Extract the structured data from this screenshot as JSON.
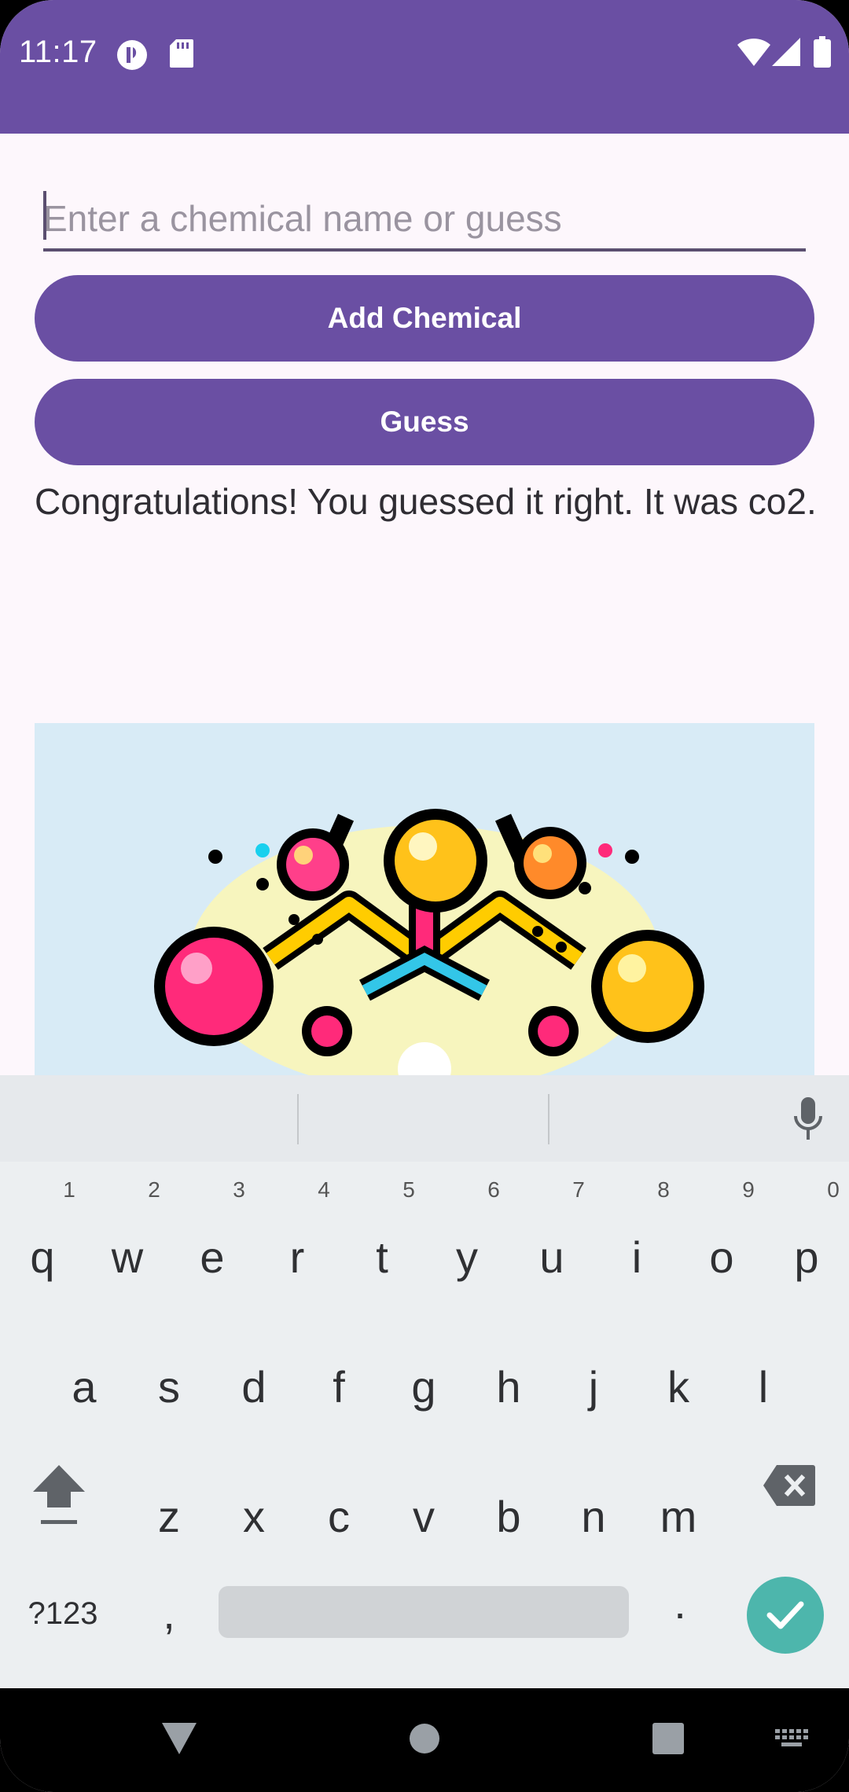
{
  "status_bar": {
    "time": "11:17",
    "icons": [
      "app-notification-icon",
      "sd-card-icon",
      "wifi-icon",
      "signal-icon",
      "battery-icon"
    ],
    "color": "#6a4fa3"
  },
  "form": {
    "input_placeholder": "Enter a chemical name or guess",
    "add_label": "Add Chemical",
    "guess_label": "Guess"
  },
  "result": {
    "message": "Congratulations! You guessed it right. It was co2."
  },
  "image": {
    "icon": "molecule-illustration",
    "background": "#d8ebf6"
  },
  "keyboard": {
    "row1": [
      "q",
      "w",
      "e",
      "r",
      "t",
      "y",
      "u",
      "i",
      "o",
      "p"
    ],
    "row1_numbers": [
      "1",
      "2",
      "3",
      "4",
      "5",
      "6",
      "7",
      "8",
      "9",
      "0"
    ],
    "row2": [
      "a",
      "s",
      "d",
      "f",
      "g",
      "h",
      "j",
      "k",
      "l"
    ],
    "row3": [
      "z",
      "x",
      "c",
      "v",
      "b",
      "n",
      "m"
    ],
    "symbols_label": "?123",
    "comma": ",",
    "period": ".",
    "enter_color": "#4db6ac"
  },
  "nav_bar": {
    "icons": [
      "back-icon",
      "home-icon",
      "recents-icon",
      "keyboard-switch-icon"
    ]
  }
}
